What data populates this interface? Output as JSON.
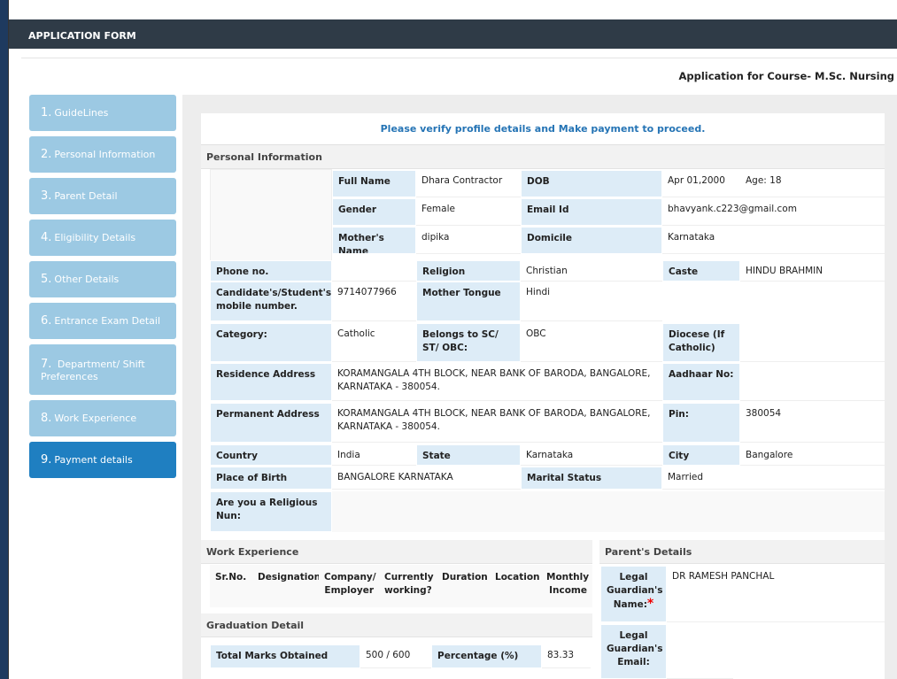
{
  "header": {
    "title": "APPLICATION FORM",
    "course": "Application for Course- M.Sc. Nursing"
  },
  "sidebar": {
    "items": [
      {
        "num": "1.",
        "label": "GuideLines"
      },
      {
        "num": "2.",
        "label": "Personal Information"
      },
      {
        "num": "3.",
        "label": "Parent Detail"
      },
      {
        "num": "4.",
        "label": "Eligibility Details"
      },
      {
        "num": "5.",
        "label": "Other Details"
      },
      {
        "num": "6.",
        "label": "Entrance Exam Detail"
      },
      {
        "num": "7.",
        "label": "Department/ Shift Preferences"
      },
      {
        "num": "8.",
        "label": "Work Experience"
      },
      {
        "num": "9.",
        "label": "Payment details"
      }
    ]
  },
  "notice": "Please verify profile details and Make payment to proceed.",
  "personal": {
    "title": "Personal Information",
    "full_name_label": "Full Name",
    "full_name": "Dhara Contractor",
    "dob_label": "DOB",
    "dob": "Apr 01,2000",
    "age": "Age: 18",
    "gender_label": "Gender",
    "gender": "Female",
    "email_label": "Email Id",
    "email": "bhavyank.c223@gmail.com",
    "mother_label": "Mother's Name",
    "mother": "dipika",
    "domicile_label": "Domicile",
    "domicile": "Karnataka",
    "phone_label": "Phone no.",
    "phone": "",
    "religion_label": "Religion",
    "religion": "Christian",
    "caste_label": "Caste",
    "caste": "HINDU BRAHMIN",
    "mobile_label": "Candidate's/Student's mobile number.",
    "mobile": "9714077966",
    "tongue_label": "Mother Tongue",
    "tongue": "Hindi",
    "category_label": "Category:",
    "category": "Catholic",
    "scst_label": "Belongs to SC/ ST/ OBC:",
    "scst": "OBC",
    "diocese_label": "Diocese (If Catholic)",
    "diocese": "",
    "res_label": "Residence Address",
    "res": "KORAMANGALA 4TH BLOCK, NEAR BANK OF BARODA, BANGALORE, KARNATAKA - 380054.",
    "aadhaar_label": "Aadhaar No:",
    "aadhaar": "",
    "perm_label": "Permanent Address",
    "perm": "KORAMANGALA 4TH BLOCK, NEAR BANK OF BARODA, BANGALORE, KARNATAKA - 380054.",
    "pin_label": "Pin:",
    "pin": "380054",
    "country_label": "Country",
    "country": "India",
    "state_label": "State",
    "state": "Karnataka",
    "city_label": "City",
    "city": "Bangalore",
    "pob_label": "Place of Birth",
    "pob": "BANGALORE KARNATAKA",
    "marital_label": "Marital Status",
    "marital": "Married",
    "nun_label": "Are you a Religious Nun:"
  },
  "work": {
    "title": "Work Experience",
    "columns": [
      "Sr.No.",
      "Designation",
      "Company/ Employer",
      "Currently working?",
      "Duration",
      "Location",
      "Monthly Income"
    ]
  },
  "parents": {
    "title": "Parent's Details",
    "guardian_name_label": "Legal Guardian's Name:",
    "guardian_name": "DR RAMESH PANCHAL",
    "guardian_email_label": "Legal Guardian's Email:"
  },
  "graduation": {
    "title": "Graduation Detail",
    "marks_label": "Total Marks Obtained",
    "marks": "500 / 600",
    "pct_label": "Percentage (%)",
    "pct": "83.33"
  }
}
